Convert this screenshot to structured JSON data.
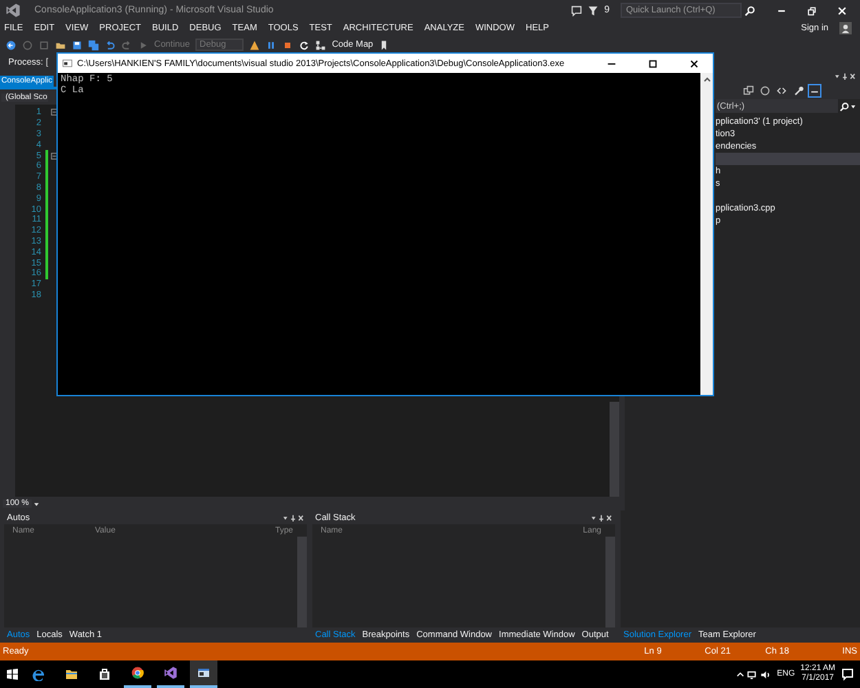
{
  "window": {
    "title": "ConsoleApplication3 (Running) - Microsoft Visual Studio",
    "notification_count": "9",
    "quick_launch": {
      "placeholder": "Quick Launch (Ctrl+Q)"
    },
    "sign_in": "Sign in"
  },
  "menu": [
    "FILE",
    "EDIT",
    "VIEW",
    "PROJECT",
    "BUILD",
    "DEBUG",
    "TEAM",
    "TOOLS",
    "TEST",
    "ARCHITECTURE",
    "ANALYZE",
    "WINDOW",
    "HELP"
  ],
  "toolbar": {
    "continue": "Continue",
    "configuration": "Debug",
    "code_map": "Code Map"
  },
  "process": {
    "label": "Process:",
    "value": "["
  },
  "editor": {
    "tab": "ConsoleApplic",
    "scope": "(Global Sco",
    "zoom": "100 %",
    "lines": [
      {
        "number": "1",
        "changed": false,
        "fold": true
      },
      {
        "number": "2",
        "changed": false,
        "fold": false
      },
      {
        "number": "3",
        "changed": false,
        "fold": false
      },
      {
        "number": "4",
        "changed": false,
        "fold": false
      },
      {
        "number": "5",
        "changed": true,
        "fold": true
      },
      {
        "number": "6",
        "changed": true,
        "fold": false
      },
      {
        "number": "7",
        "changed": true,
        "fold": false
      },
      {
        "number": "8",
        "changed": true,
        "fold": false
      },
      {
        "number": "9",
        "changed": true,
        "fold": false
      },
      {
        "number": "10",
        "changed": true,
        "fold": false
      },
      {
        "number": "11",
        "changed": true,
        "fold": false
      },
      {
        "number": "12",
        "changed": true,
        "fold": false
      },
      {
        "number": "13",
        "changed": true,
        "fold": false
      },
      {
        "number": "14",
        "changed": true,
        "fold": false
      },
      {
        "number": "15",
        "changed": true,
        "fold": false
      },
      {
        "number": "16",
        "changed": true,
        "fold": false
      },
      {
        "number": "17",
        "changed": false,
        "fold": false
      },
      {
        "number": "18",
        "changed": false,
        "fold": false
      }
    ]
  },
  "console": {
    "title": "C:\\Users\\HANKIEN'S FAMILY\\documents\\visual studio 2013\\Projects\\ConsoleApplication3\\Debug\\ConsoleApplication3.exe",
    "lines": [
      "Nhap F: 5",
      "C La"
    ]
  },
  "solution_explorer": {
    "search": {
      "placeholder": "(Ctrl+;)"
    },
    "items": [
      {
        "label": "pplication3' (1 project)",
        "selected": false
      },
      {
        "label": "tion3",
        "selected": false
      },
      {
        "label": "endencies",
        "selected": false
      },
      {
        "selected": true
      },
      {
        "label": "h",
        "selected": false
      },
      {
        "label": "s",
        "selected": false
      },
      {
        "selected": false
      },
      {
        "label": "pplication3.cpp",
        "selected": false
      },
      {
        "label": "p",
        "selected": false
      }
    ]
  },
  "autos": {
    "title": "Autos",
    "columns": [
      "Name",
      "Value",
      "Type"
    ],
    "tabs": [
      {
        "label": "Autos",
        "selected": true
      },
      {
        "label": "Locals",
        "selected": false
      },
      {
        "label": "Watch 1",
        "selected": false
      }
    ]
  },
  "call_stack": {
    "title": "Call Stack",
    "columns": [
      "Name",
      "Lang"
    ],
    "tabs": [
      {
        "label": "Call Stack",
        "selected": true
      },
      {
        "label": "Breakpoints",
        "selected": false
      },
      {
        "label": "Command Window",
        "selected": false
      },
      {
        "label": "Immediate Window",
        "selected": false
      },
      {
        "label": "Output",
        "selected": false
      }
    ]
  },
  "side_tabs": [
    {
      "label": "Solution Explorer",
      "selected": true
    },
    {
      "label": "Team Explorer",
      "selected": false
    }
  ],
  "status_bar": {
    "state": "Ready",
    "line": "Ln 9",
    "column": "Col 21",
    "char": "Ch 18",
    "mode": "INS"
  },
  "taskbar": {
    "apps": [
      {
        "kind": "edge",
        "running": false,
        "selected": false
      },
      {
        "kind": "folder",
        "running": false,
        "selected": false
      },
      {
        "kind": "store",
        "running": false,
        "selected": false
      },
      {
        "kind": "chrome",
        "running": true,
        "selected": false
      },
      {
        "kind": "vs",
        "running": true,
        "selected": false
      },
      {
        "kind": "console",
        "running": true,
        "selected": true
      }
    ],
    "language": "ENG",
    "time": "12:21 AM",
    "date": "7/1/2017"
  }
}
